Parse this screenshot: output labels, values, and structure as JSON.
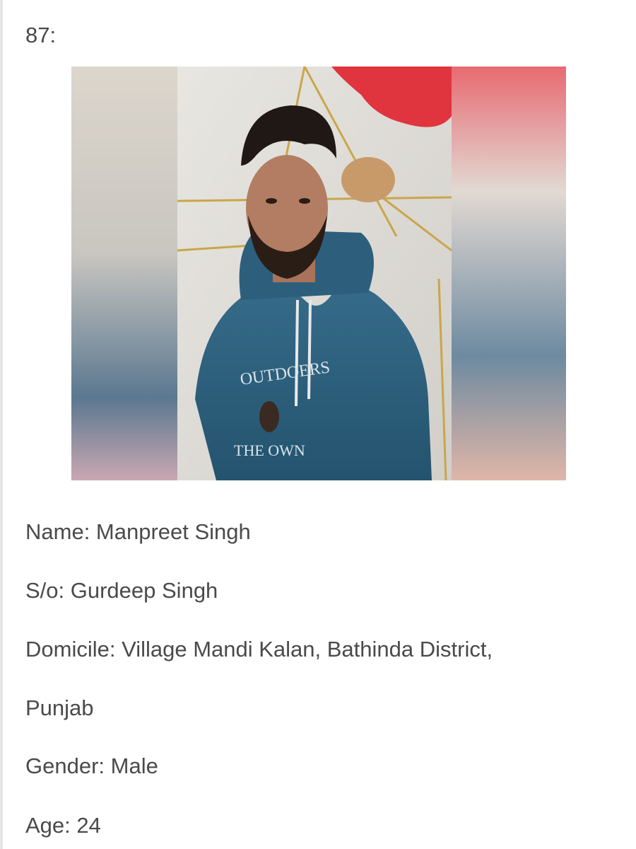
{
  "entry": {
    "number": "87:"
  },
  "photo": {
    "hoodie_print_top": "OUTDOERS",
    "hoodie_print_bottom": "THE OWN"
  },
  "profile": {
    "name_line": "Name: Manpreet Singh",
    "father_line": "S/o: Gurdeep Singh",
    "domicile_line_1": "Domicile: Village Mandi Kalan, Bathinda District,",
    "domicile_line_2": "Punjab",
    "gender_line": "Gender: Male",
    "age_line": "Age: 24"
  },
  "colors": {
    "text": "#4a4a4a",
    "hoodie": "#2f6380",
    "background_tarp": "#e3e1dc",
    "red_accent": "#e0343f"
  }
}
